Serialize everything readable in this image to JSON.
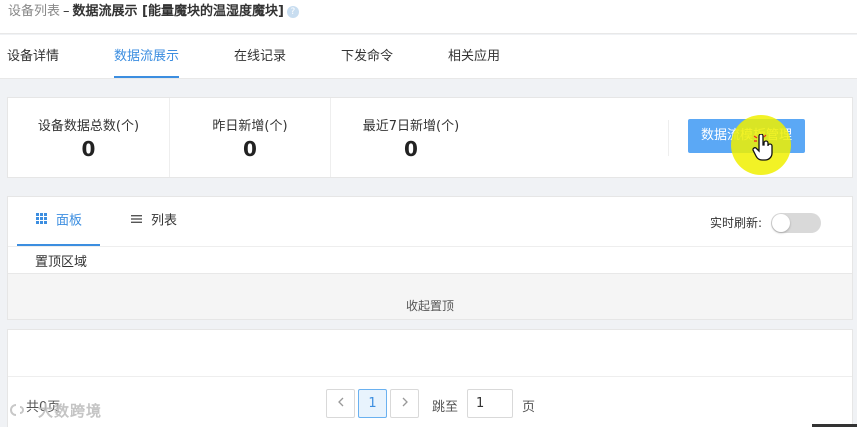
{
  "breadcrumb": {
    "root": "设备列表",
    "separator": "–",
    "current": "数据流展示 [能量魔块的温湿度魔块]",
    "help": "?"
  },
  "tabs": [
    {
      "label": "设备详情",
      "active": false
    },
    {
      "label": "数据流展示",
      "active": true
    },
    {
      "label": "在线记录",
      "active": false
    },
    {
      "label": "下发命令",
      "active": false
    },
    {
      "label": "相关应用",
      "active": false
    }
  ],
  "stats": [
    {
      "label": "设备数据总数(个)",
      "value": "0"
    },
    {
      "label": "昨日新增(个)",
      "value": "0"
    },
    {
      "label": "最近7日新增(个)",
      "value": "0"
    }
  ],
  "manage_button": "数据流模板管理",
  "views": {
    "panel": {
      "label": "面板",
      "icon": "grid-icon",
      "active": true
    },
    "list": {
      "label": "列表",
      "icon": "list-icon",
      "active": false
    }
  },
  "realtime_refresh": {
    "label": "实时刷新:",
    "enabled": false
  },
  "pinned": {
    "title": "置顶区域",
    "collapse_label": "收起置顶"
  },
  "pagination": {
    "total": "共0页",
    "prev_icon": "chevron-left-icon",
    "current_page": "1",
    "next_icon": "chevron-right-icon",
    "jump_prefix": "跳至",
    "jump_value": "1",
    "jump_suffix": "页"
  },
  "watermark": "大数跨境",
  "colors": {
    "accent": "#3c8ee0",
    "button": "#5ba8f5",
    "cursor_highlight": "#f0f000"
  }
}
